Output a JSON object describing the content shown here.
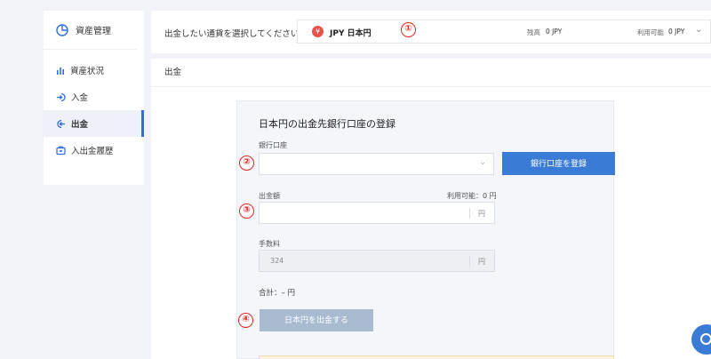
{
  "sidebar": {
    "title": "資産管理",
    "items": [
      {
        "label": "資産状況",
        "icon": "bar-chart-icon"
      },
      {
        "label": "入金",
        "icon": "deposit-icon"
      },
      {
        "label": "出金",
        "icon": "withdraw-icon",
        "active": true
      },
      {
        "label": "入出金履歴",
        "icon": "history-icon"
      }
    ]
  },
  "topbar": {
    "prompt": "出金したい通貨を選択してください",
    "currency_symbol": "¥",
    "currency": "JPY  日本円",
    "balance_label": "残高",
    "balance_value": "0 JPY",
    "available_label": "利用可能",
    "available_value": "0 JPY"
  },
  "markers": [
    "①",
    "②",
    "③",
    "④"
  ],
  "main": {
    "title": "出金",
    "form": {
      "title": "日本円の出金先銀行口座の登録",
      "bank_label": "銀行口座",
      "register_button": "銀行口座を登録",
      "amount_label": "出金額",
      "available_text": "利用可能：0 円",
      "unit": "円",
      "fee_label": "手数料",
      "fee_value": "324",
      "total": "合計：– 円",
      "submit_button": "日本円を出金する"
    }
  },
  "colors": {
    "accent": "#3a7bd5",
    "marker": "#e0271e",
    "yen_badge": "#e8524a"
  }
}
